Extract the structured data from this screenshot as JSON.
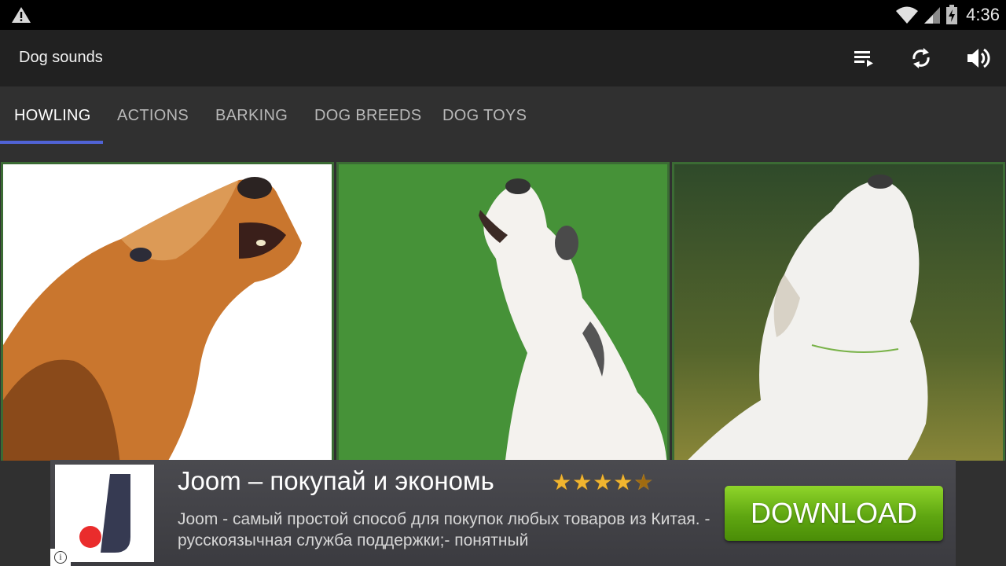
{
  "status_bar": {
    "time": "4:36",
    "icons": [
      "warning-icon",
      "wifi-icon",
      "signal-icon",
      "battery-charging-icon"
    ]
  },
  "app_bar": {
    "title": "Dog sounds",
    "actions": [
      "playlist-icon",
      "repeat-icon",
      "volume-icon"
    ]
  },
  "tabs": [
    {
      "label": "HOWLING",
      "active": true
    },
    {
      "label": "ACTIONS",
      "active": false
    },
    {
      "label": "BARKING",
      "active": false
    },
    {
      "label": "DOG BREEDS",
      "active": false
    },
    {
      "label": "DOG TOYS",
      "active": false
    }
  ],
  "colors": {
    "tab_indicator": "#5063d6",
    "card_border": "#3b6b34",
    "download_button": "#6cb81a"
  },
  "ad": {
    "headline": "Joom – покупай и экономь",
    "rating": 4.5,
    "stars_text": "★★★★",
    "half_star_text": "★",
    "body": "Joom - самый простой способ для покупок любых товаров из Китая. - русскоязычная служба поддержки;- понятный",
    "button_label": "DOWNLOAD",
    "info_label": "i"
  }
}
